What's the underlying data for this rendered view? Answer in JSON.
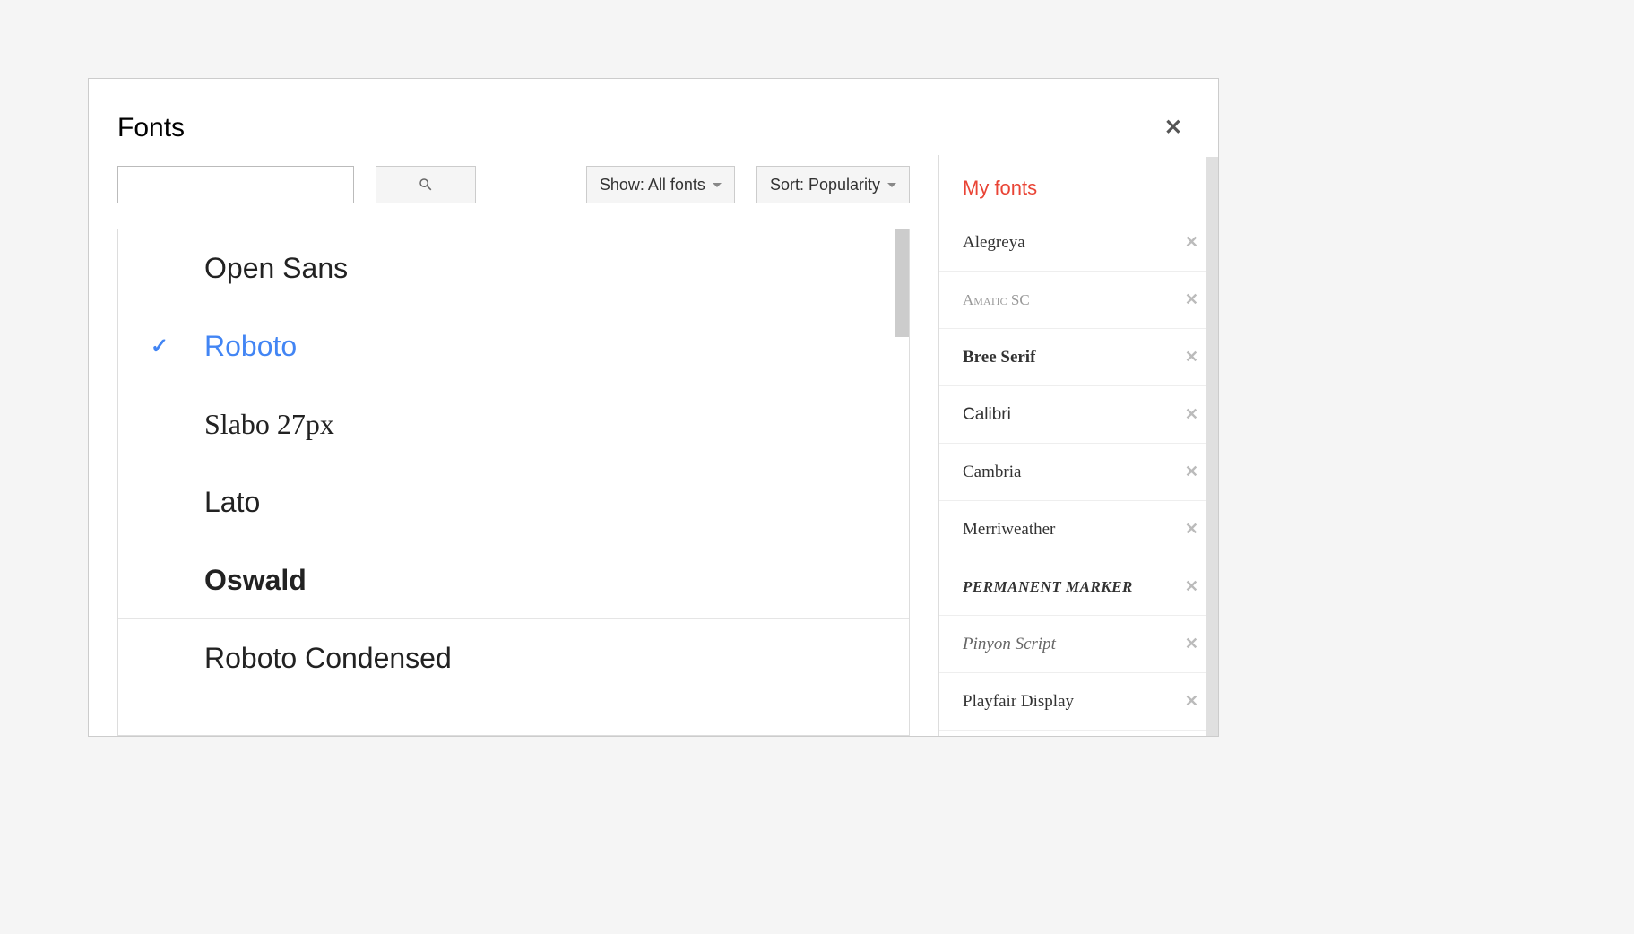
{
  "dialog": {
    "title": "Fonts"
  },
  "controls": {
    "search_value": "",
    "show_label": "Show: All fonts",
    "sort_label": "Sort: Popularity"
  },
  "fonts": [
    {
      "name": "Open Sans",
      "selected": false,
      "style": "sans"
    },
    {
      "name": "Roboto",
      "selected": true,
      "style": "sans"
    },
    {
      "name": "Slabo 27px",
      "selected": false,
      "style": "serif"
    },
    {
      "name": "Lato",
      "selected": false,
      "style": "sans"
    },
    {
      "name": "Oswald",
      "selected": false,
      "style": "condensed"
    },
    {
      "name": "Roboto Condensed",
      "selected": false,
      "style": "sans"
    }
  ],
  "myFonts": {
    "header": "My fonts",
    "items": [
      {
        "name": "Alegreya",
        "style": "serif"
      },
      {
        "name": "Amatic SC",
        "style": "thin"
      },
      {
        "name": "Bree Serif",
        "style": "bold-serif"
      },
      {
        "name": "Calibri",
        "style": "sans"
      },
      {
        "name": "Cambria",
        "style": "serif"
      },
      {
        "name": "Merriweather",
        "style": "serif"
      },
      {
        "name": "Permanent Marker",
        "style": "marker"
      },
      {
        "name": "Pinyon Script",
        "style": "script"
      },
      {
        "name": "Playfair Display",
        "style": "serif"
      }
    ]
  }
}
